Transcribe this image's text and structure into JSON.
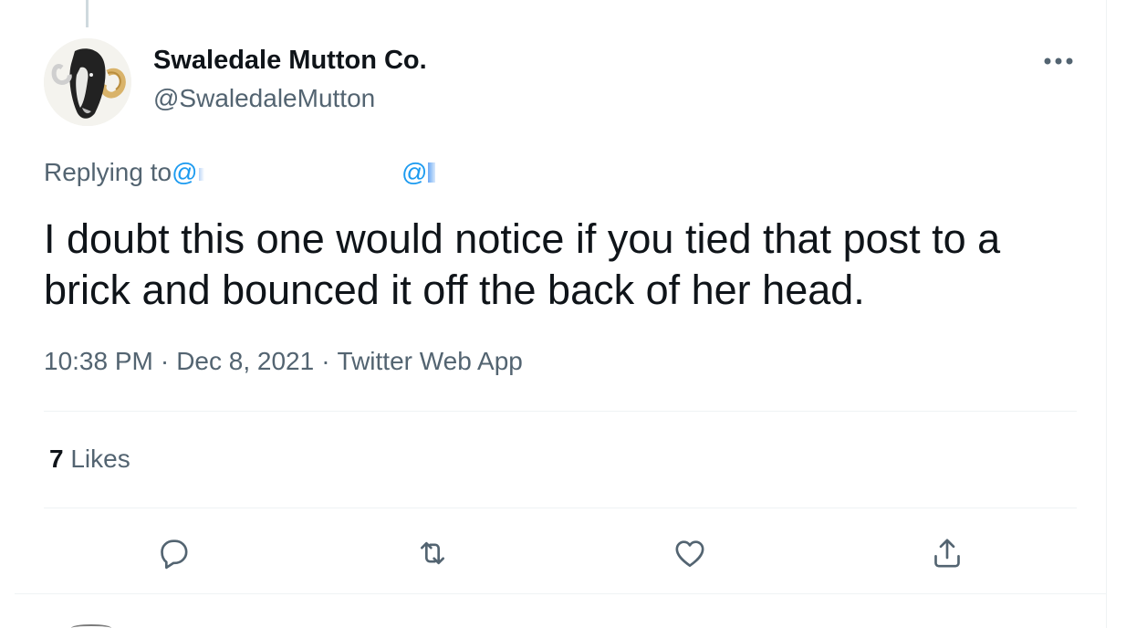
{
  "tweet": {
    "author": {
      "display_name": "Swaledale Mutton Co.",
      "handle": "@SwaledaleMutton",
      "avatar_icon": "ram-avatar-icon"
    },
    "more_icon": "more-dots-icon",
    "replying": {
      "prefix": "Replying to ",
      "mention_a": "@",
      "mention_b": "@"
    },
    "text": "I doubt this one would notice if you tied that post to a brick and bounced it off the back of her head.",
    "time": "10:38 PM",
    "date": "Dec 8, 2021",
    "separator": "·",
    "source": "Twitter Web App",
    "likes": {
      "count": "7",
      "label": "Likes"
    },
    "actions": {
      "reply_icon": "reply-bubble-icon",
      "retweet_icon": "retweet-icon",
      "like_icon": "heart-icon",
      "share_icon": "share-icon"
    }
  },
  "colors": {
    "text_primary": "#0f1419",
    "text_secondary": "#536471",
    "link": "#1d9bf0",
    "divider": "#eff3f4"
  }
}
